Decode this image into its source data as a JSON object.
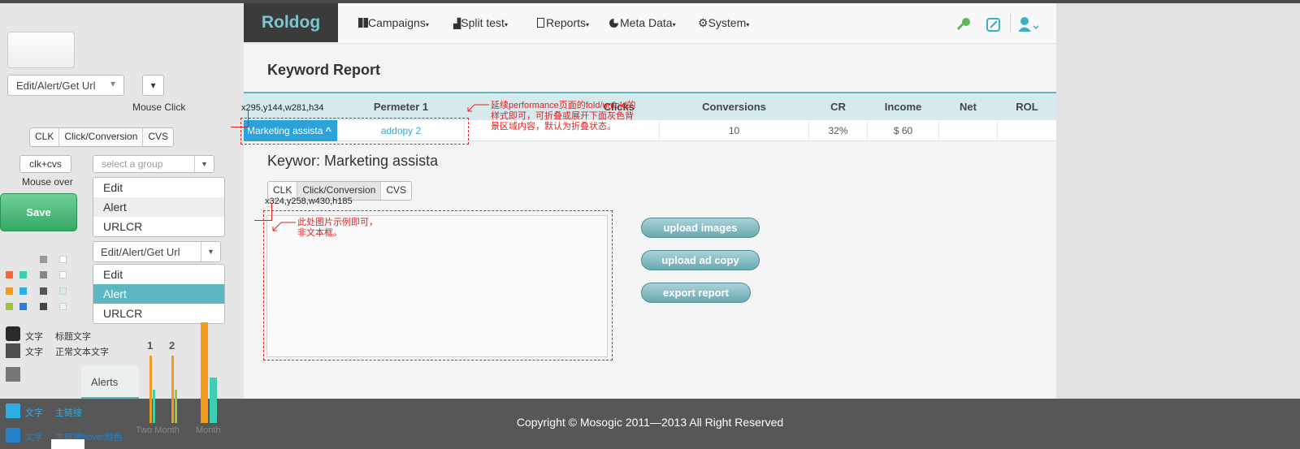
{
  "app": {
    "logo": "Roldog"
  },
  "nav": {
    "items": [
      {
        "label": "Campaigns",
        "icon": "grid-icon"
      },
      {
        "label": "Split test",
        "icon": "bar-chart-icon"
      },
      {
        "label": "Reports",
        "icon": "document-icon"
      },
      {
        "label": "Meta Data",
        "icon": "pie-chart-icon"
      },
      {
        "label": "System",
        "icon": "gear-icon"
      }
    ],
    "right_icons": [
      "key-icon",
      "edit-icon",
      "user-icon"
    ],
    "caret": "▾"
  },
  "page": {
    "title": "Keyword  Report"
  },
  "table": {
    "headers": [
      "",
      "Permeter 1",
      "Clicks",
      "Conversions",
      "CR",
      "Income",
      "Net",
      "ROL"
    ],
    "row": {
      "keyword": "Marketing assista",
      "keyword_chevron": "^",
      "param": "addopy 2",
      "clicks": "",
      "conversions": "10",
      "cr": "32%",
      "income": "$ 60",
      "net": "",
      "rol": ""
    }
  },
  "detail": {
    "heading": "Keywor:  Marketing assista",
    "tabs": [
      "CLK",
      "Click/Conversion",
      "CVS"
    ],
    "active_tab": "Click/Conversion"
  },
  "actions": {
    "upload_images": "upload images",
    "upload_ad_copy": "upload ad copy",
    "export_report": "export report"
  },
  "annotations": {
    "coord1": "x295,y144,w281,h34",
    "coord2": "x324,y258,w430,h185",
    "note1": "延续performance页面的fold/unfold的样式即可，可折叠或展开下面灰色背景区域内容，默认为折叠状态。",
    "note2": "此处图片示例即可，非文本框。"
  },
  "footer": {
    "copyright": "Copyright © Mosogic 2011—2013 All Right Reserved"
  },
  "styleguide": {
    "dropdown1": "Edit/Alert/Get Url",
    "mouse_click": "Mouse Click",
    "seg_tabs": [
      "CLK",
      "Click/Conversion",
      "CVS"
    ],
    "small_btn": "clk+cvs",
    "group_placeholder": "select a group",
    "mouse_over": "Mouse over",
    "menu1": [
      "Edit",
      "Alert",
      "URLCR"
    ],
    "save": "Save",
    "dropdown2": "Edit/Alert/Get Url",
    "menu2": [
      "Edit",
      "Alert",
      "URLCR"
    ],
    "menu2_selected": "Alert",
    "legend": [
      {
        "a": "文字",
        "b": "标题文字",
        "color": "#2a2a2a"
      },
      {
        "a": "文字",
        "b": "正常文本文字",
        "color": "#4e4e4e"
      },
      {
        "a": "",
        "b": "",
        "color": "#777777"
      },
      {
        "a": "文字",
        "b": "主链接",
        "color": "#29aee6"
      },
      {
        "a": "文字",
        "b": "主链接hover颜色",
        "color": "#2480c8"
      }
    ],
    "alerts_tab": "Alerts",
    "chart_nums": [
      "1",
      "2"
    ],
    "chart_labels": [
      "Two Month",
      "Month"
    ],
    "colors": {
      "accent": "#5cb7c2",
      "orange": "#f39a1e",
      "teal": "#3dcfb5",
      "green": "#3fb86a"
    }
  }
}
